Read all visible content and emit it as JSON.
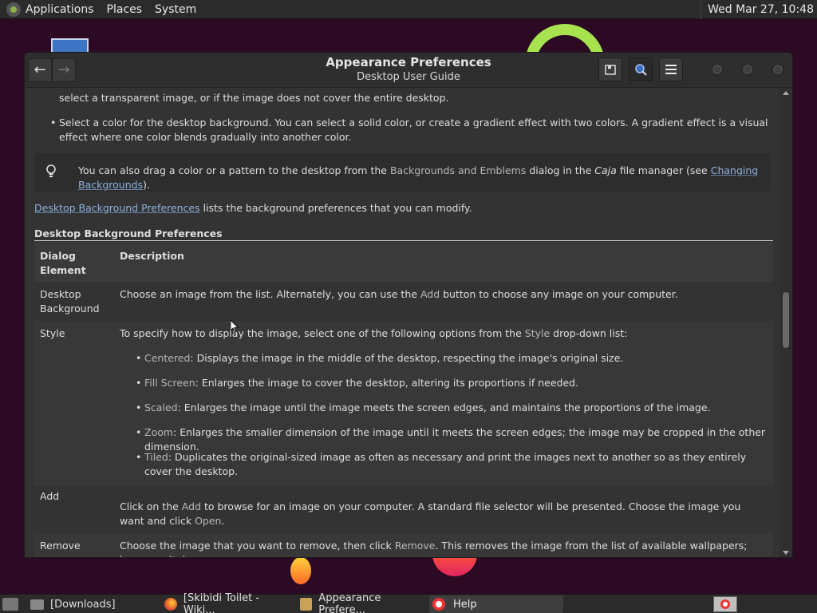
{
  "top_panel": {
    "menus": [
      "Applications",
      "Places",
      "System"
    ],
    "clock": "Wed Mar 27, 10:48"
  },
  "window": {
    "title": "Appearance Preferences",
    "subtitle": "Desktop User Guide",
    "back_label": "←",
    "forward_label": "→"
  },
  "content": {
    "para_partial": "select a transparent image, or if the image does not cover the entire desktop.",
    "bullet_color": "Select a color for the desktop background. You can select a solid color, or create a gradient effect with two colors. A gradient effect is a visual effect where one color blends gradually into another color.",
    "note": {
      "pre": "You can also drag a color or a pattern to the desktop from the ",
      "gui": "Backgrounds and Emblems",
      "mid": " dialog in the ",
      "app": "Caja",
      "mid2": " file manager (see ",
      "link": "Changing Backgrounds",
      "post": ")."
    },
    "intro_link": "Desktop Background Preferences",
    "intro_rest": " lists the background preferences that you can modify.",
    "table_title": "Desktop Background Preferences",
    "table_headers": [
      "Dialog Element",
      "Description"
    ],
    "rows": [
      {
        "element": "Desktop Background",
        "desc_pre": "Choose an image from the list. Alternately, you can use the ",
        "desc_gui": "Add",
        "desc_post": " button to choose any image on your computer."
      },
      {
        "element": "Style",
        "desc_pre": "To specify how to display the image, select one of the following options from the ",
        "desc_gui": "Style",
        "desc_post": " drop-down list:",
        "options": [
          {
            "name": "Centered",
            "text": ": Displays the image in the middle of the desktop, respecting the image's original size."
          },
          {
            "name": "Fill Screen",
            "text": ": Enlarges the image to cover the desktop, altering its proportions if needed."
          },
          {
            "name": "Scaled",
            "text": ": Enlarges the image until the image meets the screen edges, and maintains the proportions of the image."
          },
          {
            "name": "Zoom",
            "text": ": Enlarges the smaller dimension of the image until it meets the screen edges; the image may be cropped in the other dimension."
          },
          {
            "name": "Tiled",
            "text": ": Duplicates the original-sized image as often as necessary and print the images next to another so as they entirely cover the desktop."
          }
        ]
      },
      {
        "element": "Add",
        "desc_pre": "Click on the ",
        "desc_gui": "Add",
        "desc_mid": " to browse for an image on your computer. A standard file selector will be presented. Choose the image you want and click ",
        "desc_gui2": "Open",
        "desc_post": "."
      },
      {
        "element": "Remove",
        "desc_pre": "Choose the image that you want to remove, then click ",
        "desc_gui": "Remove",
        "desc_post": ". This removes the image from the list of available wallpapers; however, it does"
      }
    ]
  },
  "taskbar": {
    "items": [
      "[Downloads]",
      "[Skibidi Toilet - Wiki...",
      "Appearance Prefere...",
      "Help"
    ]
  },
  "colors": {
    "desktop_bg": "#2c0a24",
    "window_bg": "#333333",
    "link": "#8fb1dc",
    "accent_green": "#a8e34f"
  }
}
